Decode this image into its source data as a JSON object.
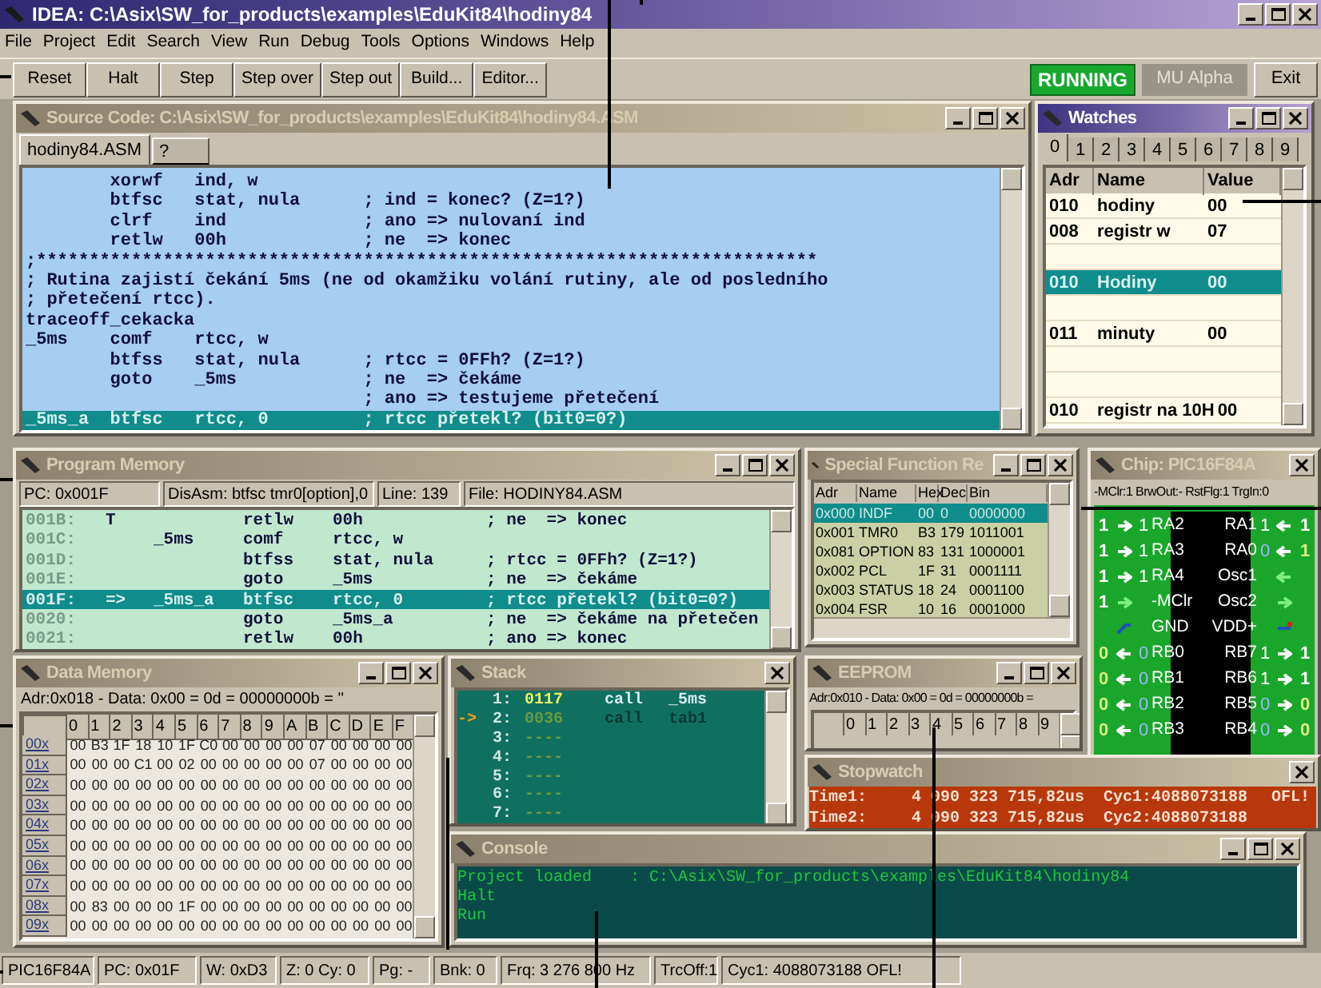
{
  "window": {
    "title": "IDEA: C:\\Asix\\SW_for_products\\examples\\EduKit84\\hodiny84"
  },
  "menu": [
    "File",
    "Project",
    "Edit",
    "Search",
    "View",
    "Run",
    "Debug",
    "Tools",
    "Options",
    "Windows",
    "Help"
  ],
  "toolbar": {
    "buttons": [
      "Reset",
      "Halt",
      "Step",
      "Step over",
      "Step out",
      "Build...",
      "Editor..."
    ],
    "state": "RUNNING",
    "mode": "MU Alpha",
    "exit": "Exit"
  },
  "source_code": {
    "title": "Source Code: C:\\Asix\\SW_for_products\\examples\\EduKit84\\hodiny84.ASM",
    "active": false,
    "close_only": false,
    "tabs": [
      {
        "label": "hodiny84.ASM",
        "selected": true
      },
      {
        "label": "?",
        "selected": false
      }
    ],
    "lines": [
      {
        "text": "        xorwf   ind, w",
        "selected": false
      },
      {
        "text": "        btfsc   stat, nula      ; ind = konec? (Z=1?)",
        "selected": false
      },
      {
        "text": "        clrf    ind             ; ano => nulovaní ind",
        "selected": false
      },
      {
        "text": "        retlw   00h             ; ne  => konec",
        "selected": false
      },
      {
        "text": ";**************************************************************************",
        "selected": false
      },
      {
        "text": "; Rutina zajistí čekání 5ms (ne od okamžiku volání rutiny, ale od posledního",
        "selected": false
      },
      {
        "text": "; přetečení rtcc).",
        "selected": false
      },
      {
        "text": "traceoff_cekacka",
        "selected": false
      },
      {
        "text": "_5ms    comf    rtcc, w",
        "selected": false
      },
      {
        "text": "        btfss   stat, nula      ; rtcc = 0FFh? (Z=1?)",
        "selected": false
      },
      {
        "text": "        goto    _5ms            ; ne  => čekáme",
        "selected": false
      },
      {
        "text": "                                ; ano => testujeme přetečení",
        "selected": false
      },
      {
        "text": "_5ms_a  btfsc   rtcc, 0         ; rtcc přetekl? (bit0=0?)",
        "selected": true
      }
    ]
  },
  "watches": {
    "title": "Watches",
    "active": true,
    "close_only": false,
    "tabs": [
      {
        "label": "0",
        "selected": true
      },
      {
        "label": "1",
        "selected": false
      },
      {
        "label": "2",
        "selected": false
      },
      {
        "label": "3",
        "selected": false
      },
      {
        "label": "4",
        "selected": false
      },
      {
        "label": "5",
        "selected": false
      },
      {
        "label": "6",
        "selected": false
      },
      {
        "label": "7",
        "selected": false
      },
      {
        "label": "8",
        "selected": false
      },
      {
        "label": "9",
        "selected": false
      }
    ],
    "columns": [
      "Adr",
      "Name",
      "Value"
    ],
    "rows": [
      {
        "kind": "entry",
        "adr": "010",
        "name": "hodiny",
        "value": "00",
        "selected": false
      },
      {
        "kind": "entry",
        "adr": "008",
        "name": "registr w",
        "value": "07",
        "selected": false
      },
      {
        "kind": "blank",
        "selected": false
      },
      {
        "kind": "entry",
        "adr": "010",
        "name": "Hodiny",
        "value": "00",
        "selected": true
      },
      {
        "kind": "blank",
        "selected": false
      },
      {
        "kind": "entry",
        "adr": "011",
        "name": "minuty",
        "value": "00",
        "selected": false
      },
      {
        "kind": "blank",
        "selected": false
      },
      {
        "kind": "blank",
        "selected": false
      },
      {
        "kind": "entry",
        "adr": "010",
        "name": "registr na 10H",
        "value": "00",
        "selected": false
      }
    ]
  },
  "program_memory": {
    "title": "Program Memory",
    "active": false,
    "close_only": false,
    "info": [
      "PC: 0x001F",
      "DisAsm: btfsc  tmr0[option],0",
      "Line: 139",
      "File: HODINY84.ASM"
    ],
    "rows": [
      {
        "addr": "001B:",
        "marker": "T",
        "mnemonic": "retlw",
        "operand": "00h",
        "comment": "; ne  => konec",
        "selected": false
      },
      {
        "addr": "001C:",
        "label": "_5ms",
        "mnemonic": "comf",
        "operand": "rtcc, w",
        "selected": false
      },
      {
        "addr": "001D:",
        "mnemonic": "btfss",
        "operand": "stat, nula",
        "comment": "; rtcc = 0FFh? (Z=1?)",
        "selected": false
      },
      {
        "addr": "001E:",
        "mnemonic": "goto",
        "operand": "_5ms",
        "comment": "; ne  => čekáme",
        "selected": false
      },
      {
        "addr": "001F:",
        "marker": "=>",
        "label": "_5ms_a",
        "mnemonic": "btfsc",
        "operand": "rtcc, 0",
        "comment": "; rtcc přetekl? (bit0=0?)",
        "selected": true
      },
      {
        "addr": "0020:",
        "mnemonic": "goto",
        "operand": "_5ms_a",
        "comment": "; ne  => čekáme na přetečen",
        "selected": false
      },
      {
        "addr": "0021:",
        "mnemonic": "retlw",
        "operand": "00h",
        "comment": "; ano => konec",
        "selected": false
      }
    ]
  },
  "special_function_registers": {
    "title": "Special Function Re",
    "active": false,
    "close_only": false,
    "columns": [
      "Adr",
      "Name",
      "Hex",
      "Dec",
      "Bin"
    ],
    "rows": [
      {
        "adr": "0x000",
        "name": "INDF",
        "hex": "00",
        "dec": "0",
        "bin": "0000000",
        "selected": true
      },
      {
        "adr": "0x001",
        "name": "TMR0",
        "hex": "B3",
        "dec": "179",
        "bin": "1011001",
        "selected": false
      },
      {
        "adr": "0x081",
        "name": "OPTION",
        "hex": "83",
        "dec": "131",
        "bin": "1000001",
        "selected": false
      },
      {
        "adr": "0x002",
        "name": "PCL",
        "hex": "1F",
        "dec": "31",
        "bin": "0001111",
        "selected": false
      },
      {
        "adr": "0x003",
        "name": "STATUS",
        "hex": "18",
        "dec": "24",
        "bin": "0001100",
        "selected": false
      },
      {
        "adr": "0x004",
        "name": "FSR",
        "hex": "10",
        "dec": "16",
        "bin": "0001000",
        "selected": false
      }
    ]
  },
  "chip": {
    "title": "Chip: PIC16F84A",
    "active": false,
    "close_only": true,
    "info": "-MClr:1 BrwOut:- RstFlg:1 TrgIn:0",
    "rows": [
      {
        "left": {
          "kind": "pin",
          "ext": "1",
          "output": false,
          "val": "1",
          "name": "RA2"
        },
        "right": {
          "kind": "pin",
          "ext": "1",
          "output": false,
          "val": "1",
          "name": "RA1"
        }
      },
      {
        "left": {
          "kind": "pin",
          "ext": "1",
          "output": false,
          "val": "1",
          "name": "RA3"
        },
        "right": {
          "kind": "pin",
          "ext": "1",
          "output": false,
          "val": "0",
          "name": "RA0"
        }
      },
      {
        "left": {
          "kind": "pin",
          "ext": "1",
          "output": false,
          "val": "1",
          "name": "RA4"
        },
        "right": {
          "kind": "osc",
          "output": false,
          "name": "Osc1"
        }
      },
      {
        "left": {
          "kind": "osc",
          "ext": "1",
          "output": false,
          "name": "-MClr"
        },
        "right": {
          "kind": "osc",
          "output": true,
          "name": "Osc2"
        }
      },
      {
        "left": {
          "kind": "power",
          "name": "GND"
        },
        "right": {
          "kind": "power",
          "name": "VDD+"
        }
      },
      {
        "left": {
          "kind": "pin",
          "ext": "0",
          "output": true,
          "val": "0",
          "name": "RB0"
        },
        "right": {
          "kind": "pin",
          "ext": "1",
          "output": true,
          "val": "1",
          "name": "RB7"
        }
      },
      {
        "left": {
          "kind": "pin",
          "ext": "0",
          "output": true,
          "val": "0",
          "name": "RB1"
        },
        "right": {
          "kind": "pin",
          "ext": "1",
          "output": true,
          "val": "1",
          "name": "RB6"
        }
      },
      {
        "left": {
          "kind": "pin",
          "ext": "0",
          "output": true,
          "val": "0",
          "name": "RB2"
        },
        "right": {
          "kind": "pin",
          "ext": "0",
          "output": true,
          "val": "0",
          "name": "RB5"
        }
      },
      {
        "left": {
          "kind": "pin",
          "ext": "0",
          "output": true,
          "val": "0",
          "name": "RB3"
        },
        "right": {
          "kind": "pin",
          "ext": "0",
          "output": true,
          "val": "0",
          "name": "RB4"
        }
      }
    ]
  },
  "data_memory": {
    "title": "Data Memory",
    "active": false,
    "close_only": false,
    "info": "Adr:0x018 - Data: 0x00 = 0d = 00000000b = ''",
    "columns": [
      "0",
      "1",
      "2",
      "3",
      "4",
      "5",
      "6",
      "7",
      "8",
      "9",
      "A",
      "B",
      "C",
      "D",
      "E",
      "F"
    ],
    "rows": [
      {
        "label": "00x",
        "cells": [
          "00",
          "B3",
          "1F",
          "18",
          "10",
          "1F",
          "C0",
          "00",
          "00",
          "00",
          "00",
          "07",
          "00",
          "00",
          "00",
          "00"
        ]
      },
      {
        "label": "01x",
        "cells": [
          "00",
          "00",
          "00",
          "C1",
          "00",
          "02",
          "00",
          "00",
          "00",
          "00",
          "00",
          "07",
          "00",
          "00",
          "00",
          "00"
        ]
      },
      {
        "label": "02x",
        "cells": [
          "00",
          "00",
          "00",
          "00",
          "00",
          "00",
          "00",
          "00",
          "00",
          "00",
          "00",
          "00",
          "00",
          "00",
          "00",
          "00"
        ]
      },
      {
        "label": "03x",
        "cells": [
          "00",
          "00",
          "00",
          "00",
          "00",
          "00",
          "00",
          "00",
          "00",
          "00",
          "00",
          "00",
          "00",
          "00",
          "00",
          "00"
        ]
      },
      {
        "label": "04x",
        "cells": [
          "00",
          "00",
          "00",
          "00",
          "00",
          "00",
          "00",
          "00",
          "00",
          "00",
          "00",
          "00",
          "00",
          "00",
          "00",
          "00"
        ]
      },
      {
        "label": "05x",
        "cells": [
          "00",
          "00",
          "00",
          "00",
          "00",
          "00",
          "00",
          "00",
          "00",
          "00",
          "00",
          "00",
          "00",
          "00",
          "00",
          "00"
        ]
      },
      {
        "label": "06x",
        "cells": [
          "00",
          "00",
          "00",
          "00",
          "00",
          "00",
          "00",
          "00",
          "00",
          "00",
          "00",
          "00",
          "00",
          "00",
          "00",
          "00"
        ]
      },
      {
        "label": "07x",
        "cells": [
          "00",
          "00",
          "00",
          "00",
          "00",
          "00",
          "00",
          "00",
          "00",
          "00",
          "00",
          "00",
          "00",
          "00",
          "00",
          "00"
        ]
      },
      {
        "label": "08x",
        "cells": [
          "00",
          "83",
          "00",
          "00",
          "00",
          "1F",
          "00",
          "00",
          "00",
          "00",
          "00",
          "00",
          "00",
          "00",
          "00",
          "00"
        ]
      },
      {
        "label": "09x",
        "cells": [
          "00",
          "00",
          "00",
          "00",
          "00",
          "00",
          "00",
          "00",
          "00",
          "00",
          "00",
          "00",
          "00",
          "00",
          "00",
          "00"
        ]
      }
    ]
  },
  "stack": {
    "title": "Stack",
    "active": false,
    "close_only": true,
    "rows": [
      {
        "index": "1:",
        "addr": "0117",
        "instr": "call",
        "target": "_5ms",
        "highlighted": true
      },
      {
        "pointer": "->",
        "index": "2:",
        "addr": "0036",
        "instr": "call",
        "target": "tab1",
        "highlighted": false
      },
      {
        "index": "3:",
        "addr": "----",
        "highlighted": false
      },
      {
        "index": "4:",
        "addr": "----",
        "highlighted": false
      },
      {
        "index": "5:",
        "addr": "----",
        "highlighted": false
      },
      {
        "index": "6:",
        "addr": "----",
        "highlighted": false
      },
      {
        "index": "7:",
        "addr": "----",
        "highlighted": false
      }
    ]
  },
  "eeprom": {
    "title": "EEPROM",
    "active": false,
    "close_only": false,
    "info": "Adr:0x010 - Data: 0x00 = 0d = 00000000b =",
    "columns": [
      "0",
      "1",
      "2",
      "3",
      "4",
      "5",
      "6",
      "7",
      "8",
      "9"
    ]
  },
  "stopwatch": {
    "title": "Stopwatch",
    "active": false,
    "close_only": true,
    "rows": [
      {
        "label": "Time1:",
        "time": "4 090 323 715,82us",
        "cycles": "Cyc1:4088073188",
        "flag": "OFL!"
      },
      {
        "label": "Time2:",
        "time": "4 090 323 715,82us",
        "cycles": "Cyc2:4088073188"
      }
    ]
  },
  "console": {
    "title": "Console",
    "active": false,
    "close_only": false,
    "lines": [
      "Project loaded    : C:\\Asix\\SW_for_products\\examples\\EduKit84\\hodiny84",
      "Halt",
      "Run"
    ]
  },
  "status_bar": [
    "PIC16F84A",
    "PC: 0x01F",
    "W: 0xD3",
    "Z: 0 Cy: 0",
    "Pg: -",
    "Bnk: 0",
    "Frq: 3 276 800 Hz",
    "TrcOff:1",
    "Cyc1: 4088073188 OFL!"
  ]
}
